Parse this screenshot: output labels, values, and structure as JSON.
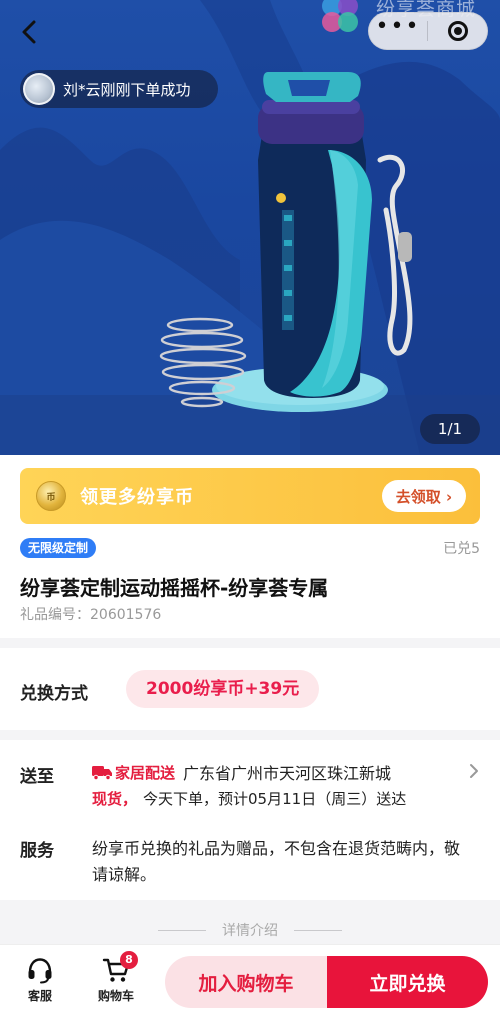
{
  "top_bar": {
    "brand_text": "纷享荟商城",
    "more_glyph": "•••"
  },
  "toast": {
    "order_text": "刘*云刚刚下单成功"
  },
  "gallery": {
    "counter": "1/1"
  },
  "coin_banner": {
    "label": "领更多纷享币",
    "button": "去领取 ›"
  },
  "product": {
    "tag": "无限级定制",
    "redeemed": "已兑5",
    "title": "纷享荟定制运动摇摇杯-纷享荟专属",
    "gift_no": "礼品编号：20601576"
  },
  "redeem": {
    "label": "兑换方式",
    "price": "2000纷享币+39元"
  },
  "delivery": {
    "label": "送至",
    "channel": "家居配送",
    "address": "广东省广州市天河区珠江新城",
    "stock": "现货，",
    "eta": "今天下单，预计05月11日（周三）送达"
  },
  "service": {
    "label": "服务",
    "text": "纷享币兑换的礼品为赠品，不包含在退货范畴内，敬请谅解。"
  },
  "detail": {
    "divider_text": "详情介绍"
  },
  "bottom_bar": {
    "service_label": "客服",
    "cart_label": "购物车",
    "cart_count": "8",
    "add_to_cart": "加入购物车",
    "redeem_now": "立即兑换"
  },
  "colors": {
    "accent_red": "#e8143b",
    "price_pink_bg": "#fde7ea",
    "banner_yellow": "#fbbf3b",
    "tag_blue": "#2f7df6",
    "hero_blue": "#1f4fa8"
  },
  "icons": [
    "back-arrow-icon",
    "more-dots-icon",
    "close-circle-icon",
    "brand-logo-icon",
    "coin-icon",
    "truck-icon",
    "chevron-right-icon",
    "headset-icon",
    "cart-icon"
  ]
}
